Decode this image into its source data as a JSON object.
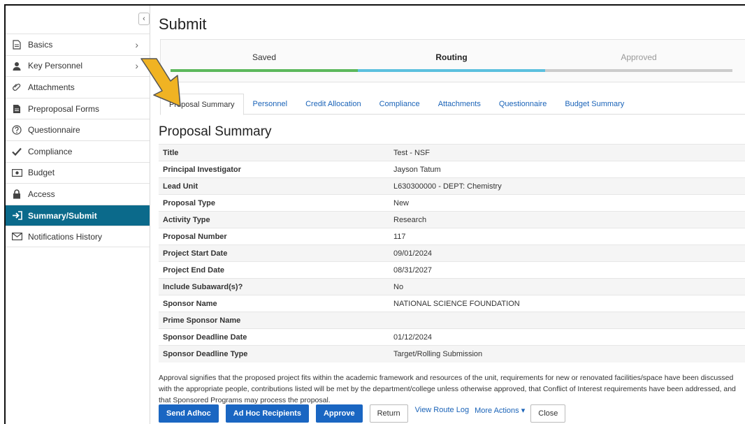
{
  "sidebar": {
    "collapse_glyph": "‹",
    "items": [
      {
        "label": "Basics",
        "icon": "document-icon",
        "has_chevron": true
      },
      {
        "label": "Key Personnel",
        "icon": "person-icon",
        "has_chevron": true
      },
      {
        "label": "Attachments",
        "icon": "paperclip-icon",
        "has_chevron": false
      },
      {
        "label": "Preproposal Forms",
        "icon": "file-icon",
        "has_chevron": false
      },
      {
        "label": "Questionnaire",
        "icon": "question-circle-icon",
        "has_chevron": false
      },
      {
        "label": "Compliance",
        "icon": "check-icon",
        "has_chevron": false
      },
      {
        "label": "Budget",
        "icon": "money-icon",
        "has_chevron": false
      },
      {
        "label": "Access",
        "icon": "lock-icon",
        "has_chevron": false
      },
      {
        "label": "Summary/Submit",
        "icon": "sign-out-icon",
        "has_chevron": false,
        "active": true
      },
      {
        "label": "Notifications History",
        "icon": "envelope-icon",
        "has_chevron": false
      }
    ]
  },
  "page_title": "Submit",
  "steps": [
    {
      "label": "Saved",
      "state": "done",
      "color": "#5cb85c"
    },
    {
      "label": "Routing",
      "state": "current",
      "color": "#5bc0de"
    },
    {
      "label": "Approved",
      "state": "pending",
      "color": "#cccccc"
    }
  ],
  "tabs": [
    "Proposal Summary",
    "Personnel",
    "Credit Allocation",
    "Compliance",
    "Attachments",
    "Questionnaire",
    "Budget Summary"
  ],
  "section_title": "Proposal Summary",
  "summary_rows": [
    {
      "label": "Title",
      "value": "Test - NSF"
    },
    {
      "label": "Principal Investigator",
      "value": "Jayson Tatum"
    },
    {
      "label": "Lead Unit",
      "value": "L630300000 - DEPT: Chemistry"
    },
    {
      "label": "Proposal Type",
      "value": "New"
    },
    {
      "label": "Activity Type",
      "value": "Research"
    },
    {
      "label": "Proposal Number",
      "value": "117"
    },
    {
      "label": "Project Start Date",
      "value": "09/01/2024"
    },
    {
      "label": "Project End Date",
      "value": "08/31/2027"
    },
    {
      "label": "Include Subaward(s)?",
      "value": "No"
    },
    {
      "label": "Sponsor Name",
      "value": "NATIONAL SCIENCE FOUNDATION"
    },
    {
      "label": "Prime Sponsor Name",
      "value": ""
    },
    {
      "label": "Sponsor Deadline Date",
      "value": "01/12/2024"
    },
    {
      "label": "Sponsor Deadline Type",
      "value": "Target/Rolling Submission"
    }
  ],
  "approval_text": "Approval signifies that the proposed project fits within the academic framework and resources of the unit, requirements for new or renovated facilities/space have been discussed with the appropriate people, contributions listed will be met by the department/college unless otherwise approved, that Conflict of Interest requirements have been addressed, and that Sponsored Programs may process the proposal.",
  "actions": {
    "send_adhoc": "Send Adhoc",
    "adhoc_recipients": "Ad Hoc Recipients",
    "approve": "Approve",
    "return": "Return",
    "view_route_log": "View Route Log",
    "more_actions": "More Actions ▾",
    "close": "Close"
  },
  "colors": {
    "active_nav": "#0b6a8b",
    "primary_button": "#1a66c2",
    "link": "#1a63b8",
    "annotation_arrow": "#f0b323"
  }
}
